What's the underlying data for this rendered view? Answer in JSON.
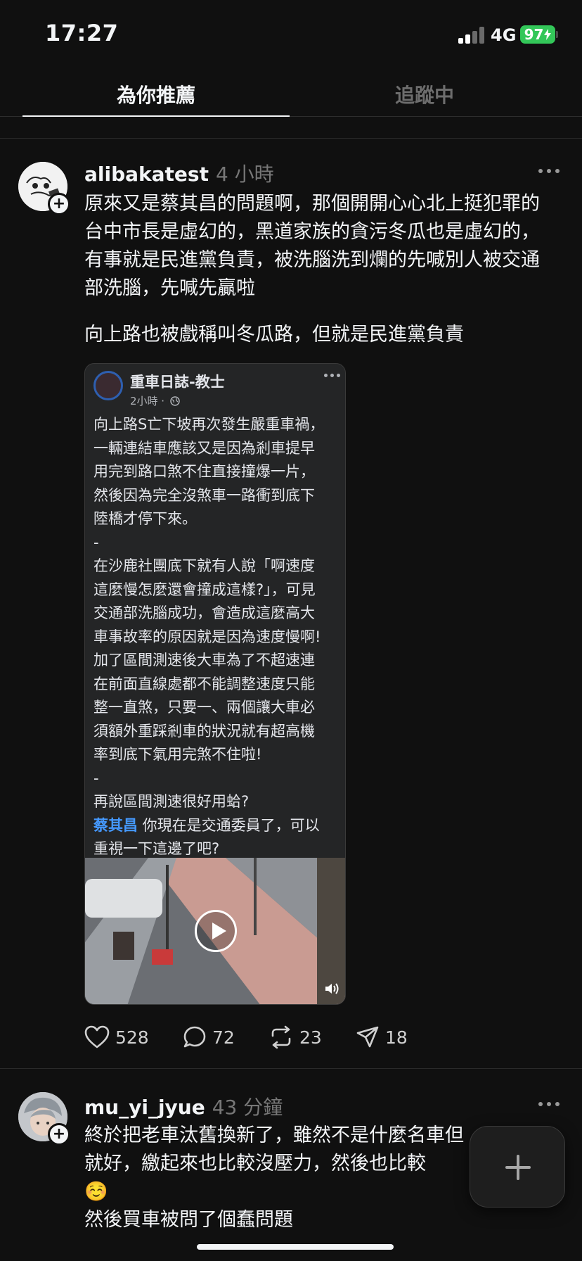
{
  "status_bar": {
    "time": "17:27",
    "network": "4G",
    "battery": "97"
  },
  "tabs": [
    {
      "label": "為你推薦"
    },
    {
      "label": "追蹤中"
    }
  ],
  "posts": [
    {
      "username": "alibakatest",
      "time_ago": "4 小時",
      "paragraphs": [
        "原來又是蔡其昌的問題啊，那個開開心心北上挺犯罪的台中市長是虛幻的，黑道家族的貪污冬瓜也是虛幻的，有事就是民進黨負責，被洗腦洗到爛的先喊別人被交通部洗腦，先喊先贏啦",
        "向上路也被戲稱叫冬瓜路，但就是民進黨負責"
      ],
      "embed": {
        "page_name": "重車日誌-教士",
        "meta": "2小時 ·",
        "lines": [
          "向上路S亡下坡再次發生嚴重車禍，",
          "一輛連結車應該又是因為剎車提早",
          "用完到路口煞不住直接撞爆一片，",
          "然後因為完全沒煞車一路衝到底下",
          "陸橋才停下來。",
          "-",
          "在沙鹿社團底下就有人說「啊速度",
          "這麼慢怎麼還會撞成這樣?」，可見",
          "交通部洗腦成功，會造成這麼高大",
          "車事故率的原因就是因為速度慢啊!",
          "加了區間測速後大車為了不超速連",
          "在前面直線處都不能調整速度只能",
          "整一直煞，只要一、兩個讓大車必",
          "須額外重踩剎車的狀況就有超高機",
          "率到底下氣用完煞不住啦!",
          "-",
          "再說區間測速很好用蛤?"
        ],
        "mention": "蔡其昌",
        "mention_rest": " 你現在是交通委員了，可以",
        "last_line": "重視一下這邊了吧?"
      },
      "stats": {
        "likes": "528",
        "comments": "72",
        "reposts": "23",
        "shares": "18"
      }
    },
    {
      "username": "mu_yi_jyue",
      "time_ago": "43 分鐘",
      "lines": [
        "終於把老車汰舊換新了，雖然不是什麼名車但",
        "就好，繳起來也比較沒壓力，然後也比較",
        "☺️",
        "然後買車被問了個蠢問題"
      ]
    }
  ]
}
